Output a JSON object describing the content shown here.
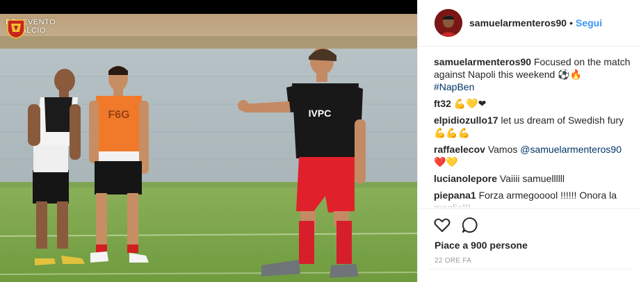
{
  "photo": {
    "club_name_line1": "BENEVENTO",
    "club_name_line2": "CALCIO",
    "jersey_text": "IVPC",
    "bib_text": "F6G"
  },
  "header": {
    "username": "samuelarmenteros90",
    "separator": "•",
    "follow_label": "Segui"
  },
  "comments": [
    {
      "user": "samuelarmenteros90",
      "text": "Focused on the match against Napoli this weekend ⚽🔥",
      "hashtag": "#NapBen"
    },
    {
      "user": "ft32",
      "text": "💪💛❤"
    },
    {
      "user": "elpidiozullo17",
      "text": "let us dream of Swedish fury 💪💪💪"
    },
    {
      "user": "raffaelecov",
      "text": "Vamos",
      "mention": "@samuelarmenteros90",
      "extra": "❤️💛"
    },
    {
      "user": "lucianolepore",
      "text": "Vaiiii samuellllll"
    },
    {
      "user": "piepana1",
      "text": "Forza armegooool !!!!!! Onora la maglia!!!"
    }
  ],
  "actions": {
    "like_icon": "heart-icon",
    "comment_icon": "comment-icon",
    "likes_text": "Piace a 900 persone",
    "timestamp": "22 ORE FA"
  },
  "colors": {
    "follow": "#3897f0",
    "text": "#262626",
    "muted": "#999999",
    "mention": "#003569"
  }
}
